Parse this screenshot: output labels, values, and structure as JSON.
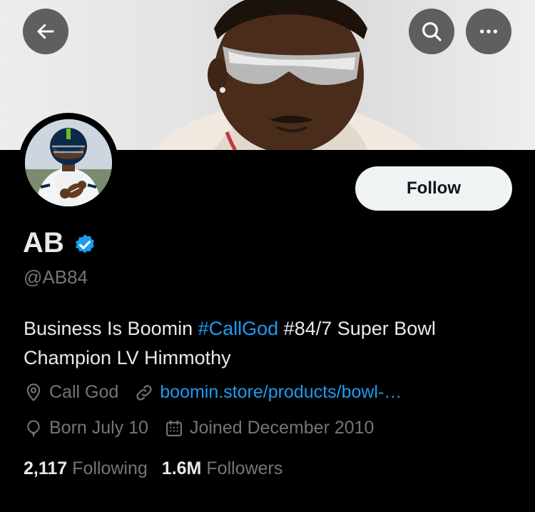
{
  "header": {
    "back_icon": "arrow-left-icon",
    "search_icon": "search-icon",
    "more_icon": "more-horizontal-icon"
  },
  "profile": {
    "display_name": "AB",
    "verified_icon": "verified-badge-icon",
    "handle": "@AB84",
    "follow_label": "Follow",
    "bio": {
      "text_before": "Business Is Boomin ",
      "hashtag": "#CallGod",
      "text_after": " #84/7 Super Bowl Champion LV Himmothy"
    },
    "location": "Call God",
    "website": "boomin.store/products/bowl-…",
    "birthday": "Born July 10",
    "joined": "Joined December 2010",
    "following_count": "2,117",
    "following_label": "Following",
    "followers_count": "1.6M",
    "followers_label": "Followers"
  },
  "colors": {
    "background": "#000000",
    "link_blue": "#1d9bf0",
    "muted_text": "#71767b",
    "primary_text": "#e7e9ea",
    "follow_button_bg": "#eff3f4"
  }
}
